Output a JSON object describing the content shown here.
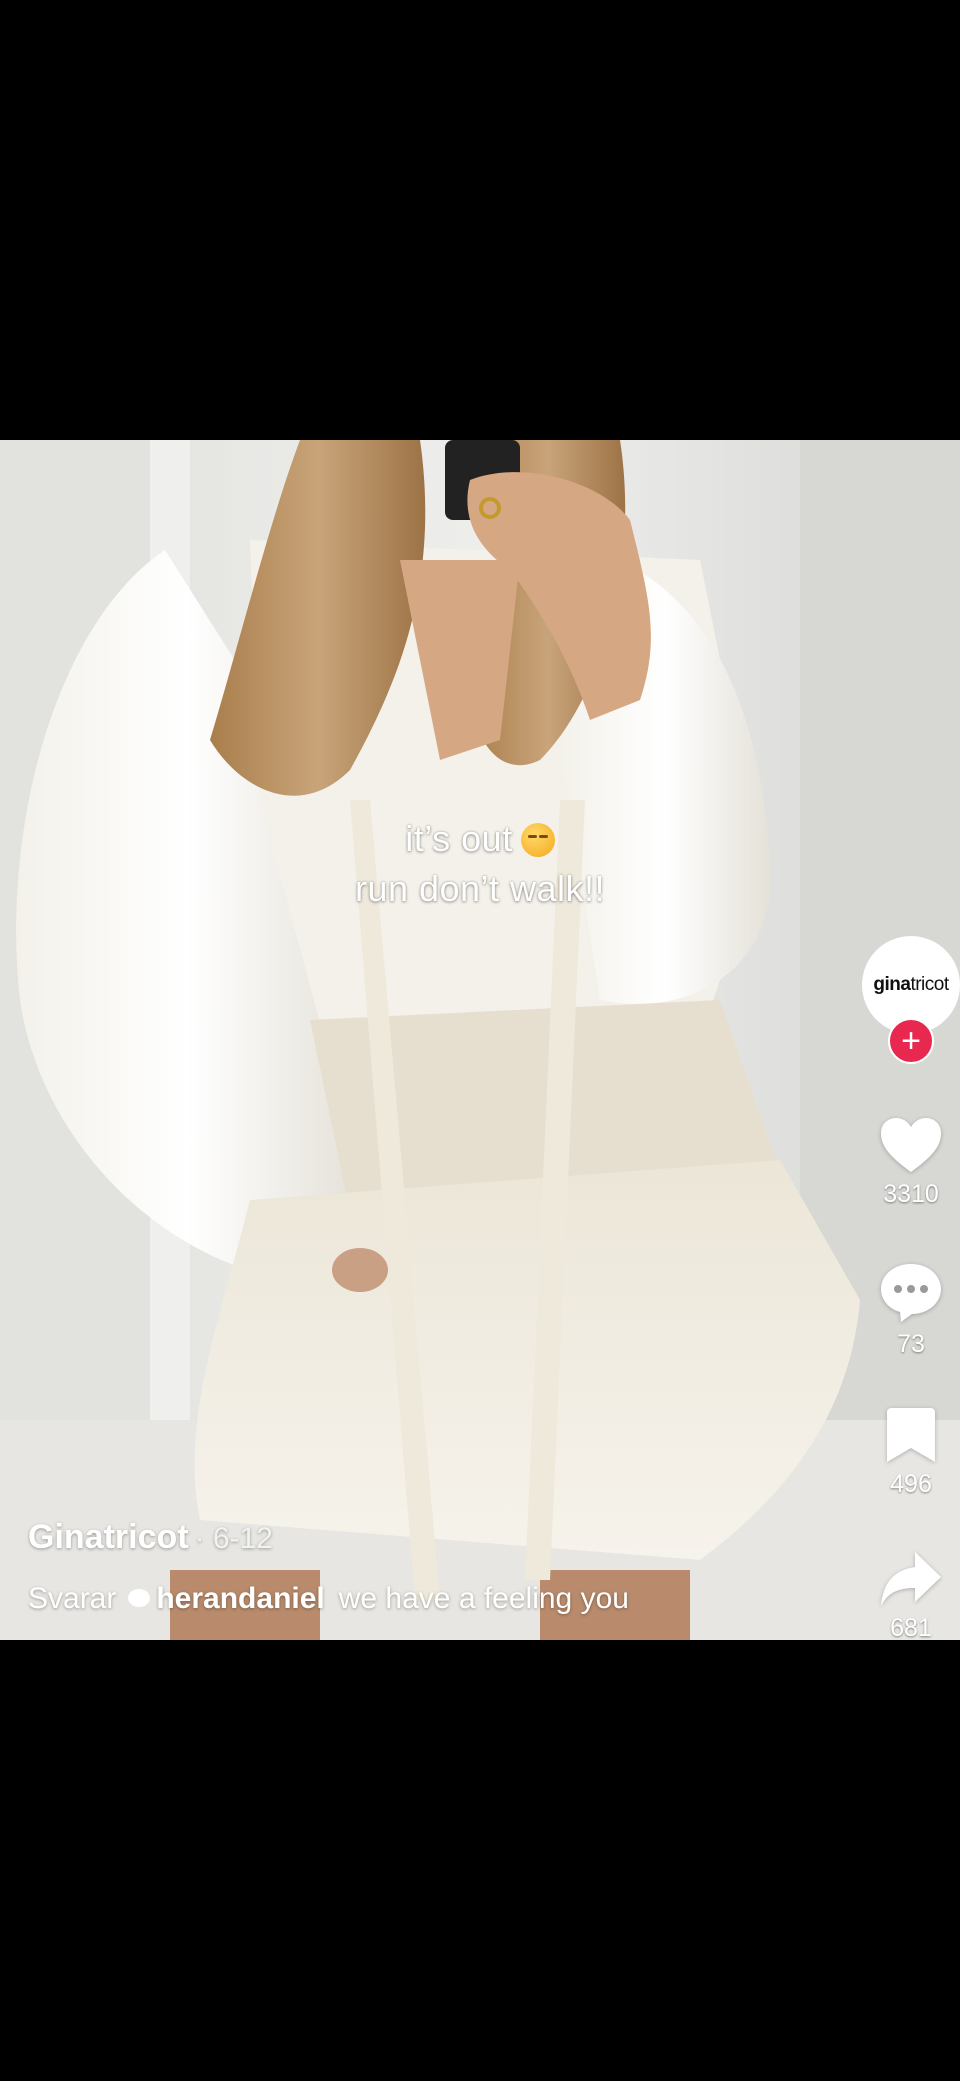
{
  "video": {
    "caption_line1": "it’s out",
    "caption_line2": "run don’t walk!!"
  },
  "rail": {
    "avatar_logo_bold": "gina",
    "avatar_logo_regular": "tricot",
    "follow_symbol": "+",
    "like_count": "3310",
    "comment_count": "73",
    "save_count": "496",
    "share_count": "681"
  },
  "post": {
    "username": "Ginatricot",
    "date": "· 6-12",
    "reply_prefix": "Svarar",
    "mention": "herandaniel",
    "description": "we have a feeling you"
  },
  "colors": {
    "follow": "#e8284e",
    "background": "#000000"
  }
}
